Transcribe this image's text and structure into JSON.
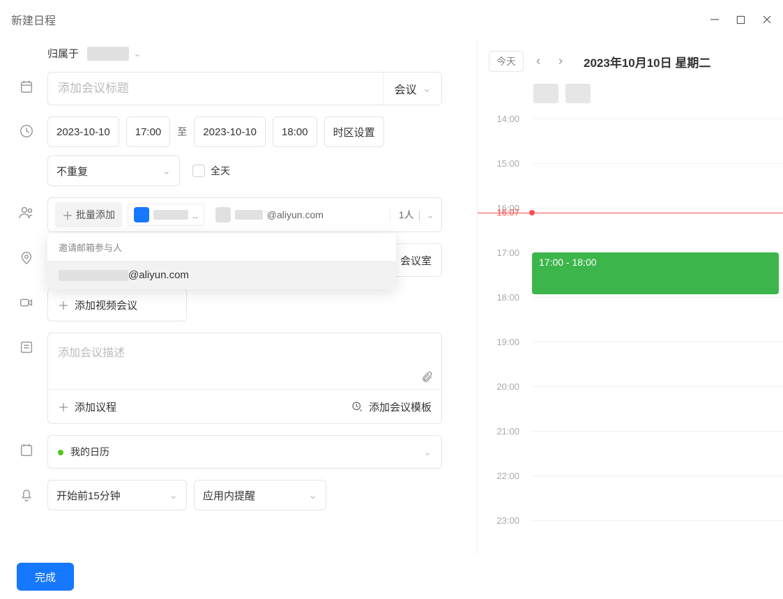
{
  "window": {
    "title": "新建日程"
  },
  "owner": {
    "label": "归属于"
  },
  "title": {
    "placeholder": "添加会议标题",
    "type_label": "会议"
  },
  "time": {
    "start_date": "2023-10-10",
    "start_time": "17:00",
    "to": "至",
    "end_date": "2023-10-10",
    "end_time": "18:00",
    "timezone_btn": "时区设置",
    "repeat": "不重复",
    "allday": "全天"
  },
  "attendees": {
    "batch": "批量添加",
    "chip1_trail": "..",
    "chip2_trail": "@aliyun.com",
    "count": "1人"
  },
  "dropdown": {
    "header": "邀请邮箱参与人",
    "item_trail": "@aliyun.com"
  },
  "location": {
    "room_btn": "会议室"
  },
  "video": {
    "add": "添加视频会议"
  },
  "desc": {
    "placeholder": "添加会议描述",
    "add_agenda": "添加议程",
    "add_template": "添加会议模板"
  },
  "calendar": {
    "name": "我的日历"
  },
  "reminder": {
    "before": "开始前15分钟",
    "method": "应用内提醒"
  },
  "footer": {
    "done": "完成"
  },
  "dayview": {
    "today": "今天",
    "date_header": "2023年10月10日 星期二",
    "now": "16:07",
    "hours": [
      "14:00",
      "15:00",
      "16:00",
      "17:00",
      "18:00",
      "19:00",
      "20:00",
      "21:00",
      "22:00",
      "23:00"
    ],
    "event_label": "17:00 - 18:00"
  }
}
